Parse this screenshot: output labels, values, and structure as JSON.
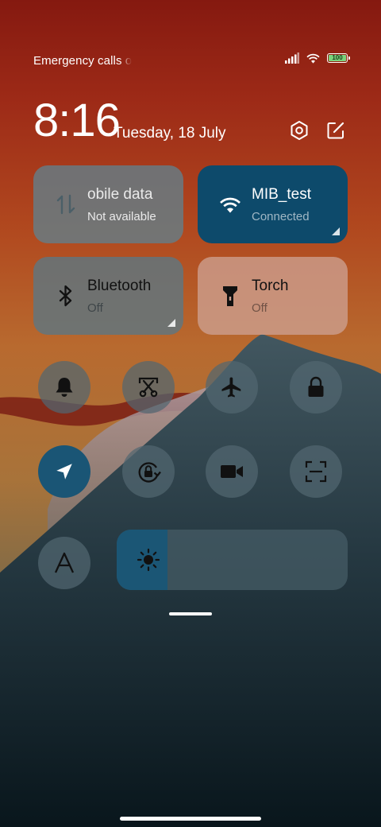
{
  "status_bar": {
    "carrier_text": "Emergency calls o",
    "battery_level": "100",
    "icons": [
      "signal-icon",
      "wifi-icon",
      "battery-icon"
    ]
  },
  "header": {
    "time": "8:16",
    "date": "Tuesday, 18 July",
    "icons": [
      "settings-icon",
      "edit-icon"
    ]
  },
  "tiles": {
    "mobile_data": {
      "title": "obile data",
      "subtitle": "Not available",
      "icon": "data-transfer-icon",
      "enabled": false
    },
    "wifi": {
      "title": "MIB_test",
      "subtitle": "Connected",
      "icon": "wifi-icon",
      "enabled": true
    },
    "bluetooth": {
      "title": "Bluetooth",
      "subtitle": "Off",
      "icon": "bluetooth-icon",
      "enabled": false
    },
    "torch": {
      "title": "Torch",
      "subtitle": "Off",
      "icon": "flashlight-icon",
      "enabled": false
    }
  },
  "toggles": [
    {
      "name": "ringer",
      "icon": "bell-icon",
      "active": false
    },
    {
      "name": "screenshot",
      "icon": "scissors-icon",
      "active": false
    },
    {
      "name": "airplane-mode",
      "icon": "airplane-icon",
      "active": false
    },
    {
      "name": "lock-screen",
      "icon": "lock-icon",
      "active": false
    },
    {
      "name": "location",
      "icon": "location-arrow-icon",
      "active": true
    },
    {
      "name": "rotation-lock",
      "icon": "rotation-lock-icon",
      "active": false
    },
    {
      "name": "screen-recorder",
      "icon": "video-camera-icon",
      "active": false
    },
    {
      "name": "scanner",
      "icon": "scan-icon",
      "active": false
    },
    {
      "name": "font-size",
      "icon": "letter-a-icon",
      "active": false
    }
  ],
  "brightness": {
    "icon": "sun-icon",
    "level": 0.22
  },
  "colors": {
    "active_tile": "#0d4a6b",
    "active_round": "#1a5575",
    "inactive_tile": "#5b7480",
    "torch_tile": "#c5988a"
  }
}
